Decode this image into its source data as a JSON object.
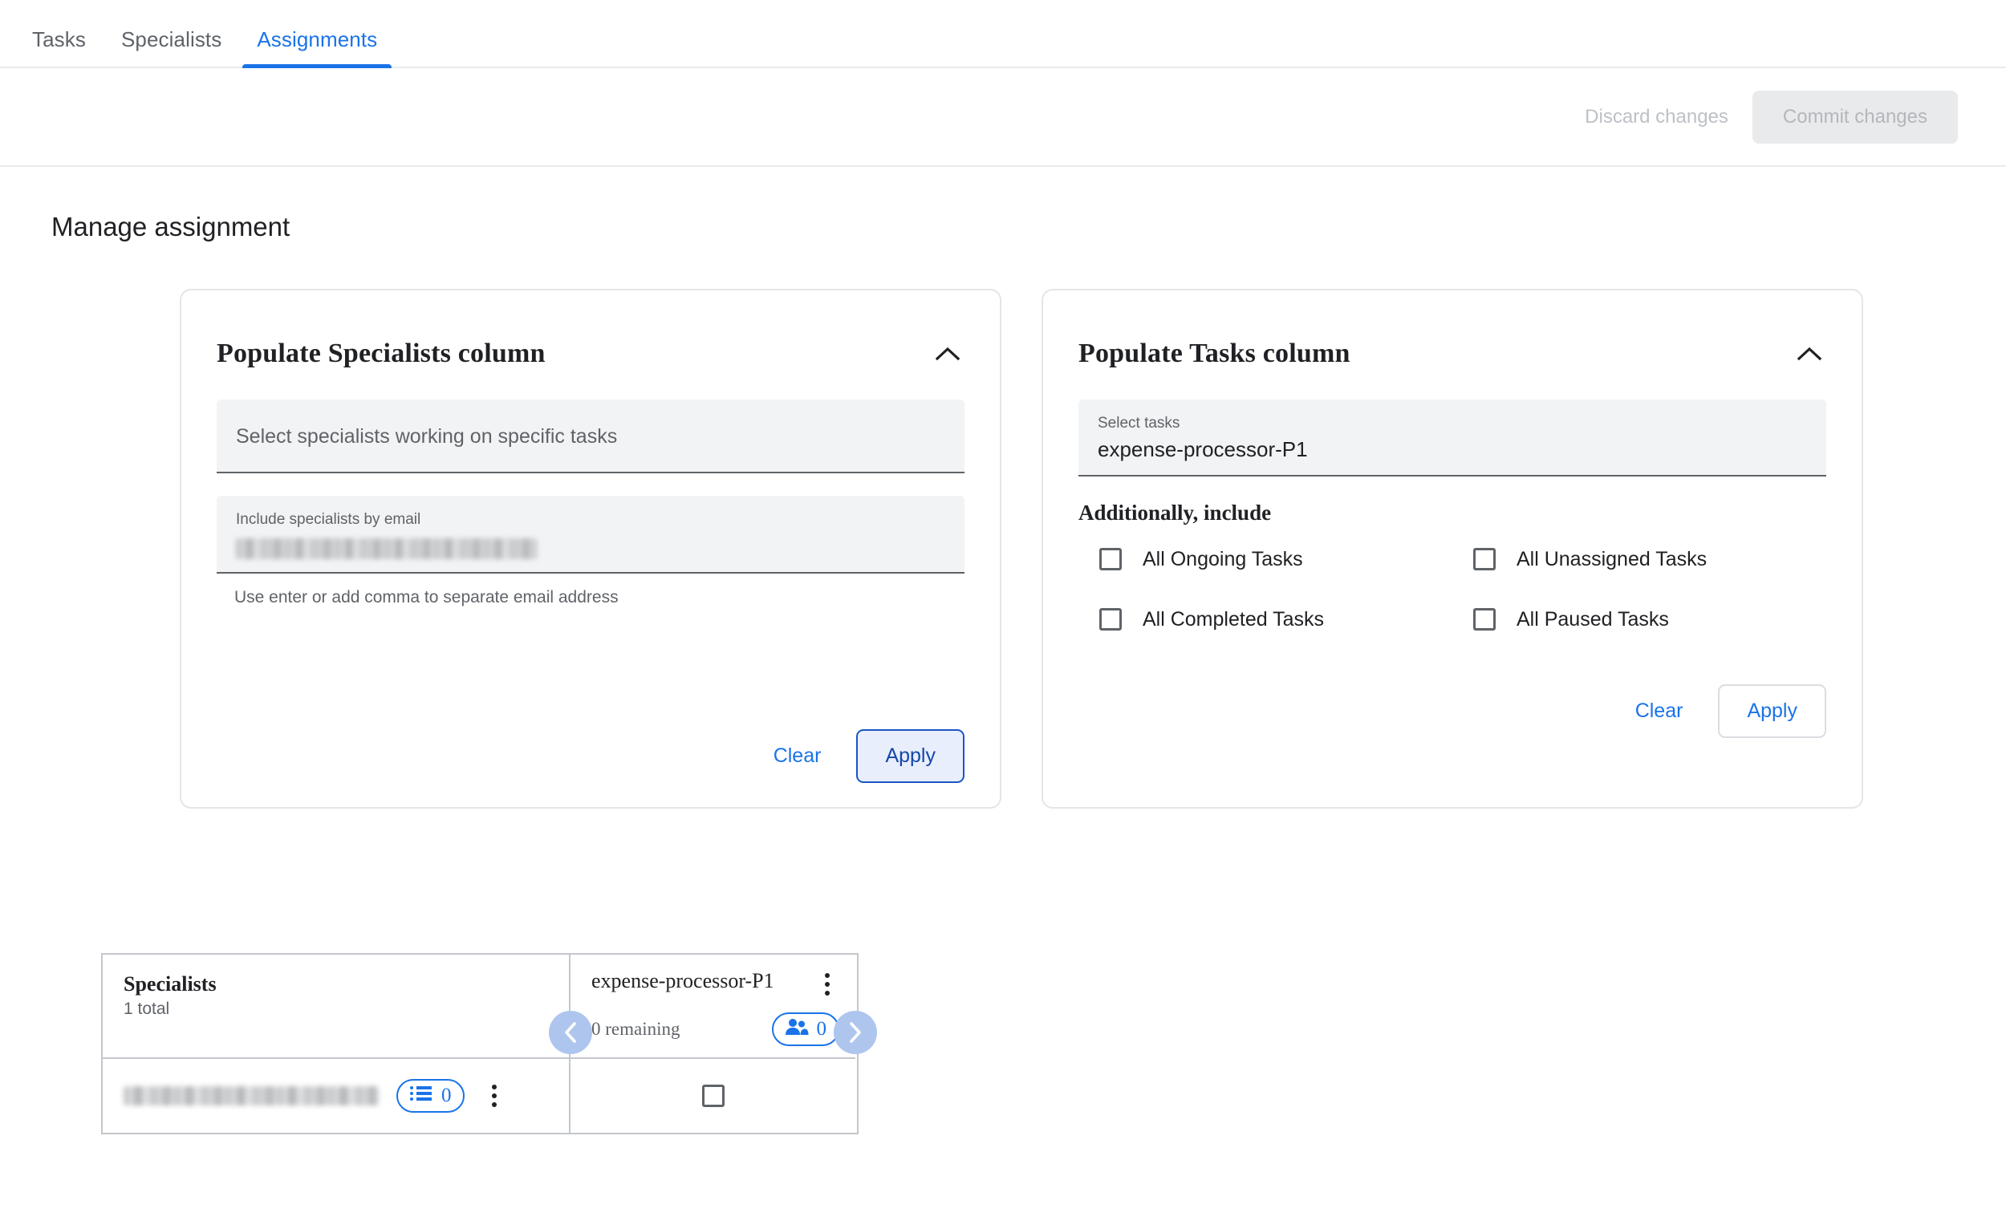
{
  "tabs": [
    {
      "label": "Tasks",
      "active": false
    },
    {
      "label": "Specialists",
      "active": false
    },
    {
      "label": "Assignments",
      "active": true
    }
  ],
  "actionbar": {
    "discard_label": "Discard changes",
    "commit_label": "Commit changes"
  },
  "page": {
    "title": "Manage assignment"
  },
  "specialists_card": {
    "title": "Populate Specialists column",
    "collapse_icon": "chevron-up-icon",
    "select_field": {
      "placeholder": "Select specialists working on specific tasks"
    },
    "email_field": {
      "label": "Include specialists by email",
      "value": "",
      "redacted": true,
      "help": "Use enter or add comma to separate email address"
    },
    "clear_label": "Clear",
    "apply_label": "Apply"
  },
  "tasks_card": {
    "title": "Populate Tasks column",
    "collapse_icon": "chevron-up-icon",
    "select_field": {
      "label": "Select tasks",
      "value": "expense-processor-P1"
    },
    "additionally_heading": "Additionally, include",
    "checkboxes": [
      {
        "label": "All Ongoing Tasks",
        "checked": false
      },
      {
        "label": "All Unassigned Tasks",
        "checked": false
      },
      {
        "label": "All Completed Tasks",
        "checked": false
      },
      {
        "label": "All Paused Tasks",
        "checked": false
      }
    ],
    "clear_label": "Clear",
    "apply_label": "Apply"
  },
  "grid": {
    "header_left": {
      "title": "Specialists",
      "subtitle": "1 total"
    },
    "header_right": {
      "task_name": "expense-processor-P1",
      "remaining": "0 remaining",
      "people_count": "0",
      "people_icon": "people-icon",
      "kebab_icon": "more-vertical-icon"
    },
    "nav": {
      "prev_icon": "chevron-left-icon",
      "next_icon": "chevron-right-icon"
    },
    "rows": [
      {
        "email": "",
        "email_redacted": true,
        "list_count": "0",
        "list_icon": "list-icon",
        "kebab_icon": "more-vertical-icon",
        "cell_checked": false
      }
    ]
  },
  "colors": {
    "accent": "#1a73e8",
    "accent_dark": "#1347a8",
    "text_primary": "#202124",
    "text_secondary": "#5f6368",
    "border": "#dadce0",
    "field_bg": "#f1f3f4",
    "nav_circle": "#aec5ee"
  }
}
